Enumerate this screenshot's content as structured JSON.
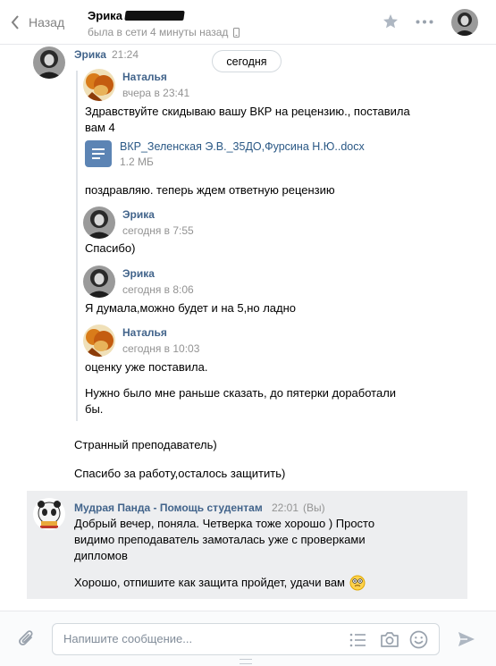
{
  "header": {
    "back_label": "Назад",
    "contact_name": "Эрика",
    "status": "была в сети 4 минуты назад"
  },
  "date_divider": "сегодня",
  "main_message": {
    "author": "Эрика",
    "time": "21:24"
  },
  "forwarded": [
    {
      "author": "Наталья",
      "time": "вчера в 23:41",
      "text_lines": [
        "Здравствуйте скидываю вашу ВКР на рецензию., поставила",
        "вам 4"
      ],
      "attachment": {
        "name": "ВКР_Зеленская Э.В._35ДО,Фурсина Н.Ю..docx",
        "size": "1.2 МБ"
      },
      "text_after": "поздравляю. теперь ждем ответную рецензию"
    },
    {
      "author": "Эрика",
      "time": "сегодня в 7:55",
      "text": "Спасибо)"
    },
    {
      "author": "Эрика",
      "time": "сегодня в 8:06",
      "text": "Я думала,можно будет и на 5,но ладно"
    },
    {
      "author": "Наталья",
      "time": "сегодня в 10:03",
      "text": "оценку уже поставила.",
      "text2_lines": [
        "Нужно было мне раньше сказать, до пятерки доработали",
        "бы."
      ]
    }
  ],
  "erika_followups": [
    "Странный преподаватель)",
    "Спасибо за работу,осталось защитить)"
  ],
  "panda_message": {
    "author": "Мудрая Панда - Помощь студентам",
    "time": "22:01",
    "tag": "(Вы)",
    "text_lines": [
      "Добрый вечер, поняла. Четверка тоже хорошо ) Просто",
      "видимо преподаватель замоталась уже с проверками",
      "дипломов"
    ],
    "text2": "Хорошо, отпишите как защита пройдет, удачи вам"
  },
  "composer": {
    "placeholder": "Напишите сообщение..."
  },
  "colors": {
    "link": "#42648b",
    "muted": "#939393",
    "own_message_bg": "#edeef0",
    "doc_icon": "#5c84b4"
  },
  "icons": [
    "chevron-left-icon",
    "phone-icon",
    "star-icon",
    "more-dots-icon",
    "document-icon",
    "paperclip-icon",
    "list-icon",
    "camera-icon",
    "emoji-icon",
    "send-icon"
  ]
}
